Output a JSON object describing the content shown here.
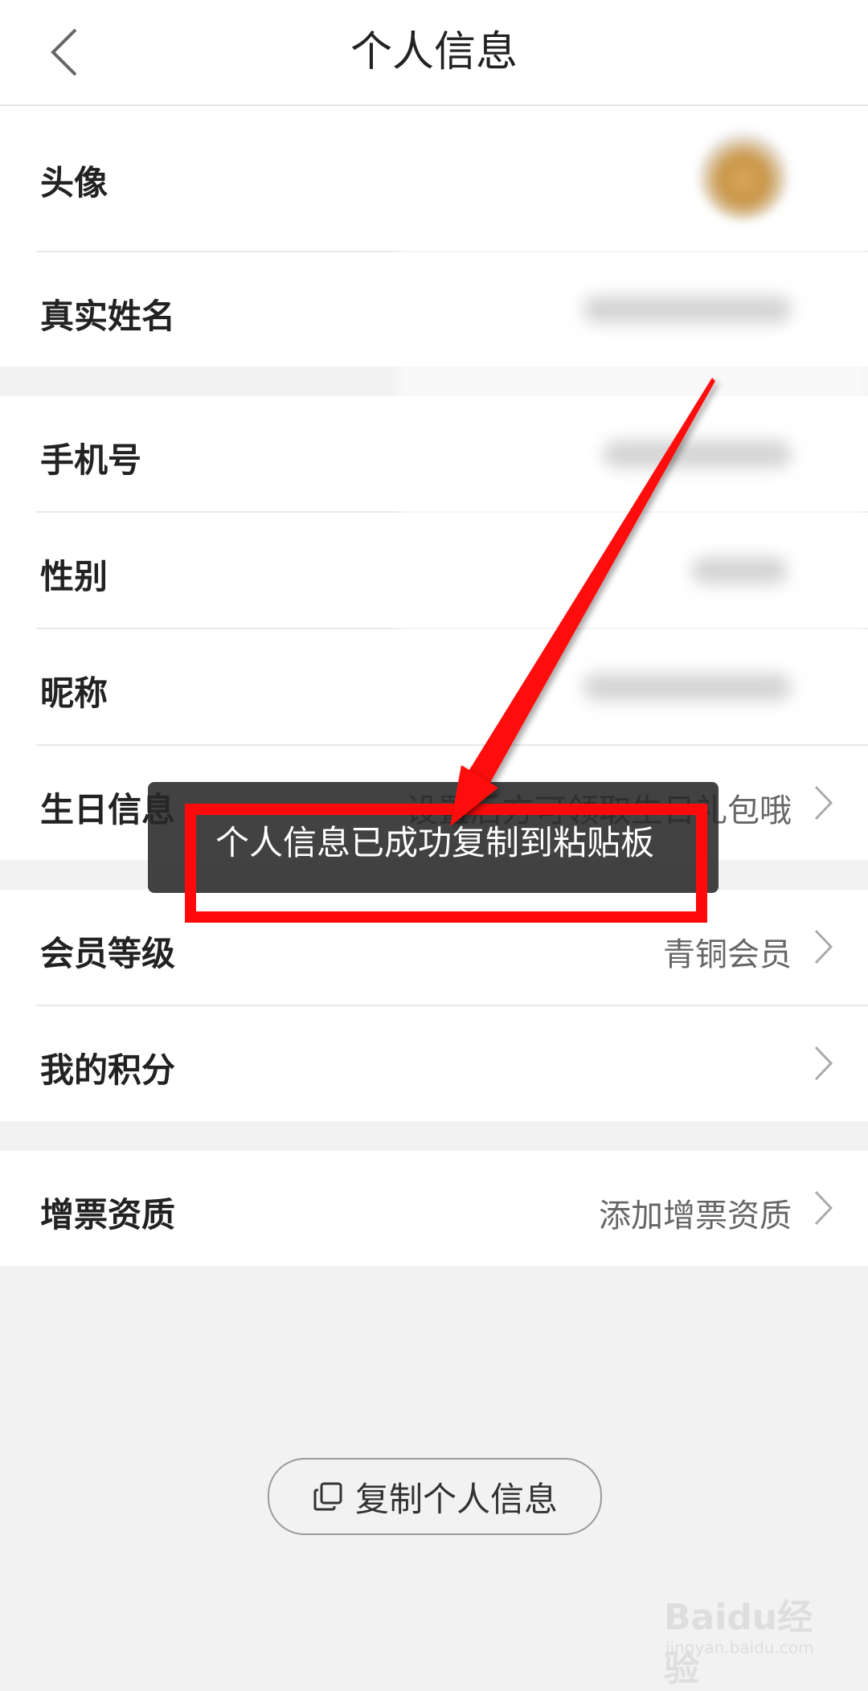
{
  "header": {
    "title": "个人信息"
  },
  "profile": {
    "avatar_label": "头像",
    "name_label": "真实姓名"
  },
  "contact": {
    "phone_label": "手机号",
    "gender_label": "性别",
    "nickname_label": "昵称",
    "birthday_label": "生日信息",
    "birthday_hint": "设置后方可领取生日礼包哦"
  },
  "member": {
    "level_label": "会员等级",
    "level_value": "青铜会员",
    "points_label": "我的积分"
  },
  "invoice": {
    "label": "增票资质",
    "value": "添加增票资质"
  },
  "toast": {
    "text": "个人信息已成功复制到粘贴板"
  },
  "copy_button": {
    "label": "复制个人信息"
  },
  "watermark": {
    "logo_text": "Baidu经验",
    "sub_text": "jingyan.baidu.com"
  },
  "colors": {
    "highlight": "#ff0a0a",
    "toast_bg": "#282828"
  }
}
